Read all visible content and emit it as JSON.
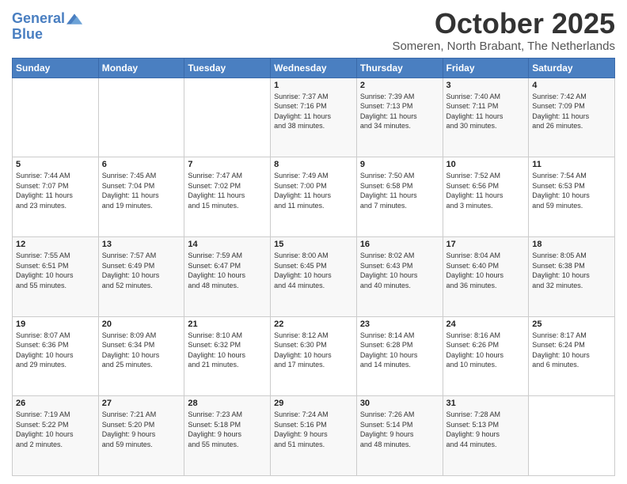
{
  "header": {
    "logo_line1": "General",
    "logo_line2": "Blue",
    "month_title": "October 2025",
    "location": "Someren, North Brabant, The Netherlands"
  },
  "days_of_week": [
    "Sunday",
    "Monday",
    "Tuesday",
    "Wednesday",
    "Thursday",
    "Friday",
    "Saturday"
  ],
  "weeks": [
    [
      {
        "day": "",
        "info": ""
      },
      {
        "day": "",
        "info": ""
      },
      {
        "day": "",
        "info": ""
      },
      {
        "day": "1",
        "info": "Sunrise: 7:37 AM\nSunset: 7:16 PM\nDaylight: 11 hours\nand 38 minutes."
      },
      {
        "day": "2",
        "info": "Sunrise: 7:39 AM\nSunset: 7:13 PM\nDaylight: 11 hours\nand 34 minutes."
      },
      {
        "day": "3",
        "info": "Sunrise: 7:40 AM\nSunset: 7:11 PM\nDaylight: 11 hours\nand 30 minutes."
      },
      {
        "day": "4",
        "info": "Sunrise: 7:42 AM\nSunset: 7:09 PM\nDaylight: 11 hours\nand 26 minutes."
      }
    ],
    [
      {
        "day": "5",
        "info": "Sunrise: 7:44 AM\nSunset: 7:07 PM\nDaylight: 11 hours\nand 23 minutes."
      },
      {
        "day": "6",
        "info": "Sunrise: 7:45 AM\nSunset: 7:04 PM\nDaylight: 11 hours\nand 19 minutes."
      },
      {
        "day": "7",
        "info": "Sunrise: 7:47 AM\nSunset: 7:02 PM\nDaylight: 11 hours\nand 15 minutes."
      },
      {
        "day": "8",
        "info": "Sunrise: 7:49 AM\nSunset: 7:00 PM\nDaylight: 11 hours\nand 11 minutes."
      },
      {
        "day": "9",
        "info": "Sunrise: 7:50 AM\nSunset: 6:58 PM\nDaylight: 11 hours\nand 7 minutes."
      },
      {
        "day": "10",
        "info": "Sunrise: 7:52 AM\nSunset: 6:56 PM\nDaylight: 11 hours\nand 3 minutes."
      },
      {
        "day": "11",
        "info": "Sunrise: 7:54 AM\nSunset: 6:53 PM\nDaylight: 10 hours\nand 59 minutes."
      }
    ],
    [
      {
        "day": "12",
        "info": "Sunrise: 7:55 AM\nSunset: 6:51 PM\nDaylight: 10 hours\nand 55 minutes."
      },
      {
        "day": "13",
        "info": "Sunrise: 7:57 AM\nSunset: 6:49 PM\nDaylight: 10 hours\nand 52 minutes."
      },
      {
        "day": "14",
        "info": "Sunrise: 7:59 AM\nSunset: 6:47 PM\nDaylight: 10 hours\nand 48 minutes."
      },
      {
        "day": "15",
        "info": "Sunrise: 8:00 AM\nSunset: 6:45 PM\nDaylight: 10 hours\nand 44 minutes."
      },
      {
        "day": "16",
        "info": "Sunrise: 8:02 AM\nSunset: 6:43 PM\nDaylight: 10 hours\nand 40 minutes."
      },
      {
        "day": "17",
        "info": "Sunrise: 8:04 AM\nSunset: 6:40 PM\nDaylight: 10 hours\nand 36 minutes."
      },
      {
        "day": "18",
        "info": "Sunrise: 8:05 AM\nSunset: 6:38 PM\nDaylight: 10 hours\nand 32 minutes."
      }
    ],
    [
      {
        "day": "19",
        "info": "Sunrise: 8:07 AM\nSunset: 6:36 PM\nDaylight: 10 hours\nand 29 minutes."
      },
      {
        "day": "20",
        "info": "Sunrise: 8:09 AM\nSunset: 6:34 PM\nDaylight: 10 hours\nand 25 minutes."
      },
      {
        "day": "21",
        "info": "Sunrise: 8:10 AM\nSunset: 6:32 PM\nDaylight: 10 hours\nand 21 minutes."
      },
      {
        "day": "22",
        "info": "Sunrise: 8:12 AM\nSunset: 6:30 PM\nDaylight: 10 hours\nand 17 minutes."
      },
      {
        "day": "23",
        "info": "Sunrise: 8:14 AM\nSunset: 6:28 PM\nDaylight: 10 hours\nand 14 minutes."
      },
      {
        "day": "24",
        "info": "Sunrise: 8:16 AM\nSunset: 6:26 PM\nDaylight: 10 hours\nand 10 minutes."
      },
      {
        "day": "25",
        "info": "Sunrise: 8:17 AM\nSunset: 6:24 PM\nDaylight: 10 hours\nand 6 minutes."
      }
    ],
    [
      {
        "day": "26",
        "info": "Sunrise: 7:19 AM\nSunset: 5:22 PM\nDaylight: 10 hours\nand 2 minutes."
      },
      {
        "day": "27",
        "info": "Sunrise: 7:21 AM\nSunset: 5:20 PM\nDaylight: 9 hours\nand 59 minutes."
      },
      {
        "day": "28",
        "info": "Sunrise: 7:23 AM\nSunset: 5:18 PM\nDaylight: 9 hours\nand 55 minutes."
      },
      {
        "day": "29",
        "info": "Sunrise: 7:24 AM\nSunset: 5:16 PM\nDaylight: 9 hours\nand 51 minutes."
      },
      {
        "day": "30",
        "info": "Sunrise: 7:26 AM\nSunset: 5:14 PM\nDaylight: 9 hours\nand 48 minutes."
      },
      {
        "day": "31",
        "info": "Sunrise: 7:28 AM\nSunset: 5:13 PM\nDaylight: 9 hours\nand 44 minutes."
      },
      {
        "day": "",
        "info": ""
      }
    ]
  ]
}
